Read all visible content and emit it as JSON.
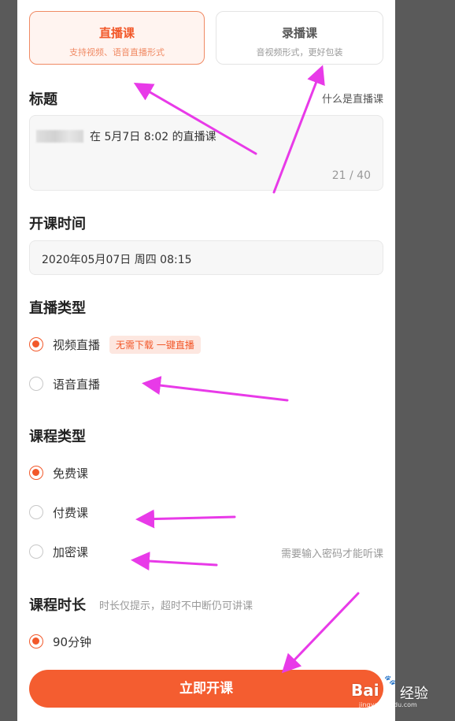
{
  "course_mode": {
    "live": {
      "title": "直播课",
      "subtitle": "支持视频、语音直播形式"
    },
    "recorded": {
      "title": "录播课",
      "subtitle": "音视频形式，更好包装"
    }
  },
  "title_section": {
    "heading": "标题",
    "help_link": "什么是直播课",
    "value": "在 5月7日 8:02 的直播课",
    "counter": "21 / 40"
  },
  "start_time": {
    "heading": "开课时间",
    "value": "2020年05月07日 周四 08:15"
  },
  "live_type": {
    "heading": "直播类型",
    "options": [
      {
        "label": "视频直播",
        "badge": "无需下载 一键直播",
        "selected": true
      },
      {
        "label": "语音直播",
        "selected": false
      }
    ]
  },
  "course_type": {
    "heading": "课程类型",
    "options": [
      {
        "label": "免费课",
        "selected": true
      },
      {
        "label": "付费课",
        "selected": false
      },
      {
        "label": "加密课",
        "selected": false,
        "hint": "需要输入密码才能听课"
      }
    ]
  },
  "duration": {
    "heading": "课程时长",
    "hint": "时长仅提示，超时不中断仍可讲课",
    "options": [
      {
        "label": "90分钟",
        "selected": true
      }
    ]
  },
  "primary_action": {
    "label": "立即开课"
  },
  "watermark": {
    "brand": "Bai",
    "brand_suffix": "经验",
    "url": "jingyan.baidu.com"
  },
  "colors": {
    "accent": "#f45d30",
    "annotation_arrow": "#e83ae8"
  }
}
